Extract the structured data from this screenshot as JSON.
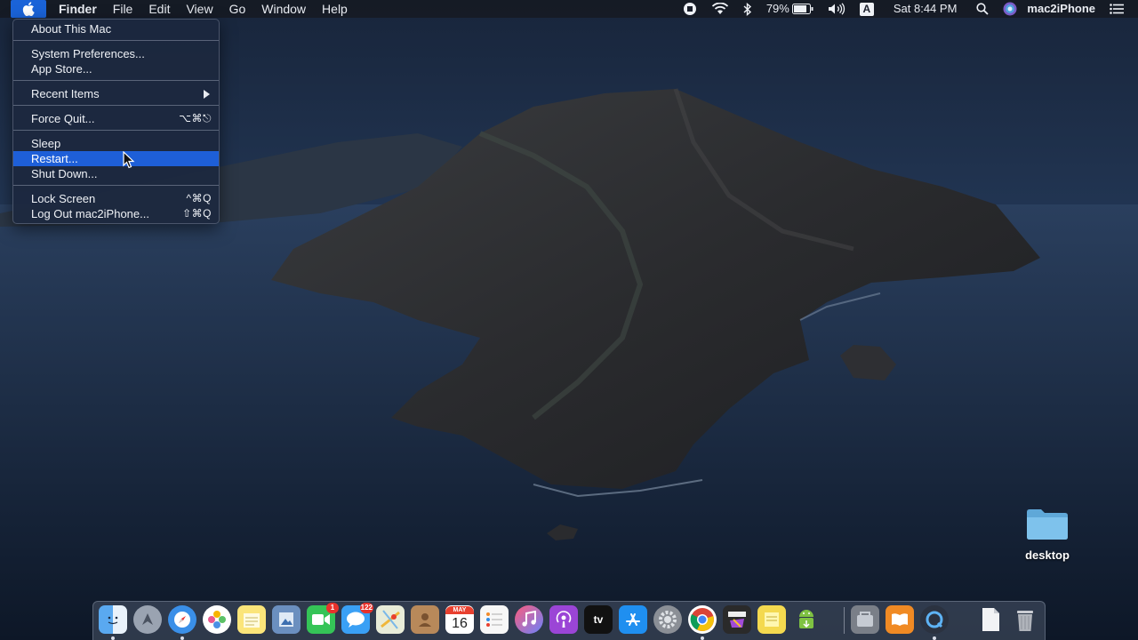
{
  "menubar": {
    "app_name": "Finder",
    "menus": [
      "File",
      "Edit",
      "View",
      "Go",
      "Window",
      "Help"
    ],
    "battery": "79%",
    "input_source": "A",
    "clock": "Sat 8:44 PM",
    "user": "mac2iPhone"
  },
  "apple_menu": {
    "about": "About This Mac",
    "system_prefs": "System Preferences...",
    "app_store": "App Store...",
    "recent_items": "Recent Items",
    "force_quit": "Force Quit...",
    "force_quit_shortcut": "⌥⌘⎋",
    "sleep": "Sleep",
    "restart": "Restart...",
    "shut_down": "Shut Down...",
    "lock_screen": "Lock Screen",
    "lock_screen_shortcut": "^⌘Q",
    "log_out": "Log Out mac2iPhone...",
    "log_out_shortcut": "⇧⌘Q"
  },
  "desktop": {
    "folder_label": "desktop"
  },
  "dock": {
    "facetime_badge": "1",
    "messages_badge": "122",
    "calendar_month": "MAY",
    "calendar_day": "16",
    "tv_label": "tv",
    "items": [
      "finder-icon",
      "launchpad-icon",
      "safari-icon",
      "photos-icon",
      "notes-icon",
      "preview-icon",
      "facetime-icon",
      "messages-icon",
      "maps-icon",
      "contacts-icon",
      "calendar-icon",
      "reminders-icon",
      "music-icon",
      "podcasts-icon",
      "apple-tv-icon",
      "app-store-icon",
      "system-preferences-icon",
      "chrome-icon",
      "final-cut-pro-icon",
      "stickies-icon",
      "android-file-transfer-icon",
      "utility-icon",
      "books-icon",
      "quicktime-icon",
      "document-icon",
      "trash-icon"
    ]
  },
  "colors": {
    "highlight": "#1e5fd8",
    "menu_bg": "#1c283e",
    "ocean": "#102036",
    "island": "#2a2a2c"
  }
}
